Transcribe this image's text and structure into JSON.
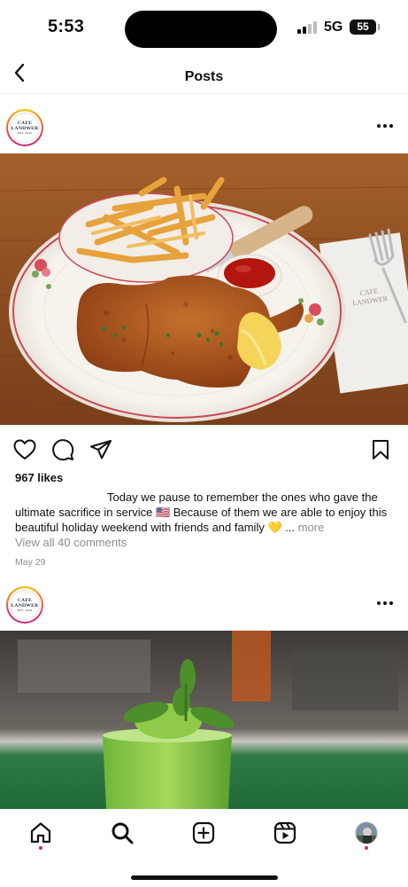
{
  "status": {
    "time": "5:53",
    "network": "5G",
    "battery": "55"
  },
  "header": {
    "title": "Posts"
  },
  "post1": {
    "account_logo": {
      "line1": "CAFE",
      "line2": "LANDWER",
      "line3": "EST. 1919"
    },
    "likes": "967 likes",
    "caption_text": "Today we pause to remember the ones who gave the ultimate sacrifice in service 🇺🇸 Because of them we are able to enjoy this beautiful holiday weekend with friends and family 💛",
    "caption_ellipsis": "...",
    "more_label": "more",
    "view_comments": "View all 40 comments",
    "date": "May 29"
  },
  "post2": {
    "account_logo": {
      "line1": "CAFE",
      "line2": "LANDWER",
      "line3": "EST. 1919"
    }
  },
  "napkin_text": {
    "line1": "CAFE",
    "line2": "LANDWER"
  },
  "icons": {
    "back": "chevron-left-icon",
    "more": "more-horizontal-icon",
    "like": "heart-icon",
    "comment": "comment-icon",
    "share": "send-icon",
    "save": "bookmark-icon",
    "home": "home-icon",
    "search": "search-icon",
    "create": "plus-square-icon",
    "reels": "reels-icon"
  },
  "colors": {
    "notification_dot": "#e0245e",
    "secondary_text": "#8e8e8e"
  }
}
